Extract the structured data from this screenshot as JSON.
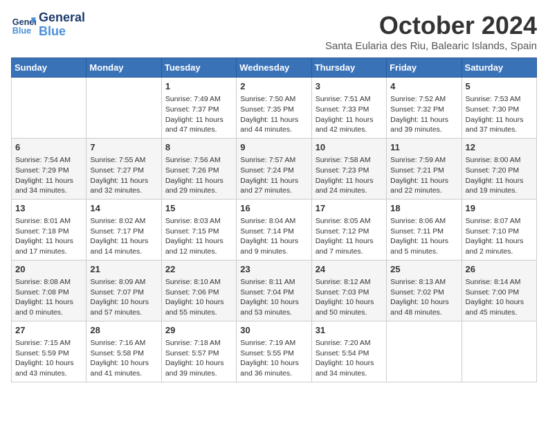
{
  "header": {
    "logo_line1": "General",
    "logo_line2": "Blue",
    "month_title": "October 2024",
    "subtitle": "Santa Eularia des Riu, Balearic Islands, Spain"
  },
  "days_of_week": [
    "Sunday",
    "Monday",
    "Tuesday",
    "Wednesday",
    "Thursday",
    "Friday",
    "Saturday"
  ],
  "weeks": [
    [
      {
        "day": "",
        "info": ""
      },
      {
        "day": "",
        "info": ""
      },
      {
        "day": "1",
        "info": "Sunrise: 7:49 AM\nSunset: 7:37 PM\nDaylight: 11 hours and 47 minutes."
      },
      {
        "day": "2",
        "info": "Sunrise: 7:50 AM\nSunset: 7:35 PM\nDaylight: 11 hours and 44 minutes."
      },
      {
        "day": "3",
        "info": "Sunrise: 7:51 AM\nSunset: 7:33 PM\nDaylight: 11 hours and 42 minutes."
      },
      {
        "day": "4",
        "info": "Sunrise: 7:52 AM\nSunset: 7:32 PM\nDaylight: 11 hours and 39 minutes."
      },
      {
        "day": "5",
        "info": "Sunrise: 7:53 AM\nSunset: 7:30 PM\nDaylight: 11 hours and 37 minutes."
      }
    ],
    [
      {
        "day": "6",
        "info": "Sunrise: 7:54 AM\nSunset: 7:29 PM\nDaylight: 11 hours and 34 minutes."
      },
      {
        "day": "7",
        "info": "Sunrise: 7:55 AM\nSunset: 7:27 PM\nDaylight: 11 hours and 32 minutes."
      },
      {
        "day": "8",
        "info": "Sunrise: 7:56 AM\nSunset: 7:26 PM\nDaylight: 11 hours and 29 minutes."
      },
      {
        "day": "9",
        "info": "Sunrise: 7:57 AM\nSunset: 7:24 PM\nDaylight: 11 hours and 27 minutes."
      },
      {
        "day": "10",
        "info": "Sunrise: 7:58 AM\nSunset: 7:23 PM\nDaylight: 11 hours and 24 minutes."
      },
      {
        "day": "11",
        "info": "Sunrise: 7:59 AM\nSunset: 7:21 PM\nDaylight: 11 hours and 22 minutes."
      },
      {
        "day": "12",
        "info": "Sunrise: 8:00 AM\nSunset: 7:20 PM\nDaylight: 11 hours and 19 minutes."
      }
    ],
    [
      {
        "day": "13",
        "info": "Sunrise: 8:01 AM\nSunset: 7:18 PM\nDaylight: 11 hours and 17 minutes."
      },
      {
        "day": "14",
        "info": "Sunrise: 8:02 AM\nSunset: 7:17 PM\nDaylight: 11 hours and 14 minutes."
      },
      {
        "day": "15",
        "info": "Sunrise: 8:03 AM\nSunset: 7:15 PM\nDaylight: 11 hours and 12 minutes."
      },
      {
        "day": "16",
        "info": "Sunrise: 8:04 AM\nSunset: 7:14 PM\nDaylight: 11 hours and 9 minutes."
      },
      {
        "day": "17",
        "info": "Sunrise: 8:05 AM\nSunset: 7:12 PM\nDaylight: 11 hours and 7 minutes."
      },
      {
        "day": "18",
        "info": "Sunrise: 8:06 AM\nSunset: 7:11 PM\nDaylight: 11 hours and 5 minutes."
      },
      {
        "day": "19",
        "info": "Sunrise: 8:07 AM\nSunset: 7:10 PM\nDaylight: 11 hours and 2 minutes."
      }
    ],
    [
      {
        "day": "20",
        "info": "Sunrise: 8:08 AM\nSunset: 7:08 PM\nDaylight: 11 hours and 0 minutes."
      },
      {
        "day": "21",
        "info": "Sunrise: 8:09 AM\nSunset: 7:07 PM\nDaylight: 10 hours and 57 minutes."
      },
      {
        "day": "22",
        "info": "Sunrise: 8:10 AM\nSunset: 7:06 PM\nDaylight: 10 hours and 55 minutes."
      },
      {
        "day": "23",
        "info": "Sunrise: 8:11 AM\nSunset: 7:04 PM\nDaylight: 10 hours and 53 minutes."
      },
      {
        "day": "24",
        "info": "Sunrise: 8:12 AM\nSunset: 7:03 PM\nDaylight: 10 hours and 50 minutes."
      },
      {
        "day": "25",
        "info": "Sunrise: 8:13 AM\nSunset: 7:02 PM\nDaylight: 10 hours and 48 minutes."
      },
      {
        "day": "26",
        "info": "Sunrise: 8:14 AM\nSunset: 7:00 PM\nDaylight: 10 hours and 45 minutes."
      }
    ],
    [
      {
        "day": "27",
        "info": "Sunrise: 7:15 AM\nSunset: 5:59 PM\nDaylight: 10 hours and 43 minutes."
      },
      {
        "day": "28",
        "info": "Sunrise: 7:16 AM\nSunset: 5:58 PM\nDaylight: 10 hours and 41 minutes."
      },
      {
        "day": "29",
        "info": "Sunrise: 7:18 AM\nSunset: 5:57 PM\nDaylight: 10 hours and 39 minutes."
      },
      {
        "day": "30",
        "info": "Sunrise: 7:19 AM\nSunset: 5:55 PM\nDaylight: 10 hours and 36 minutes."
      },
      {
        "day": "31",
        "info": "Sunrise: 7:20 AM\nSunset: 5:54 PM\nDaylight: 10 hours and 34 minutes."
      },
      {
        "day": "",
        "info": ""
      },
      {
        "day": "",
        "info": ""
      }
    ]
  ]
}
